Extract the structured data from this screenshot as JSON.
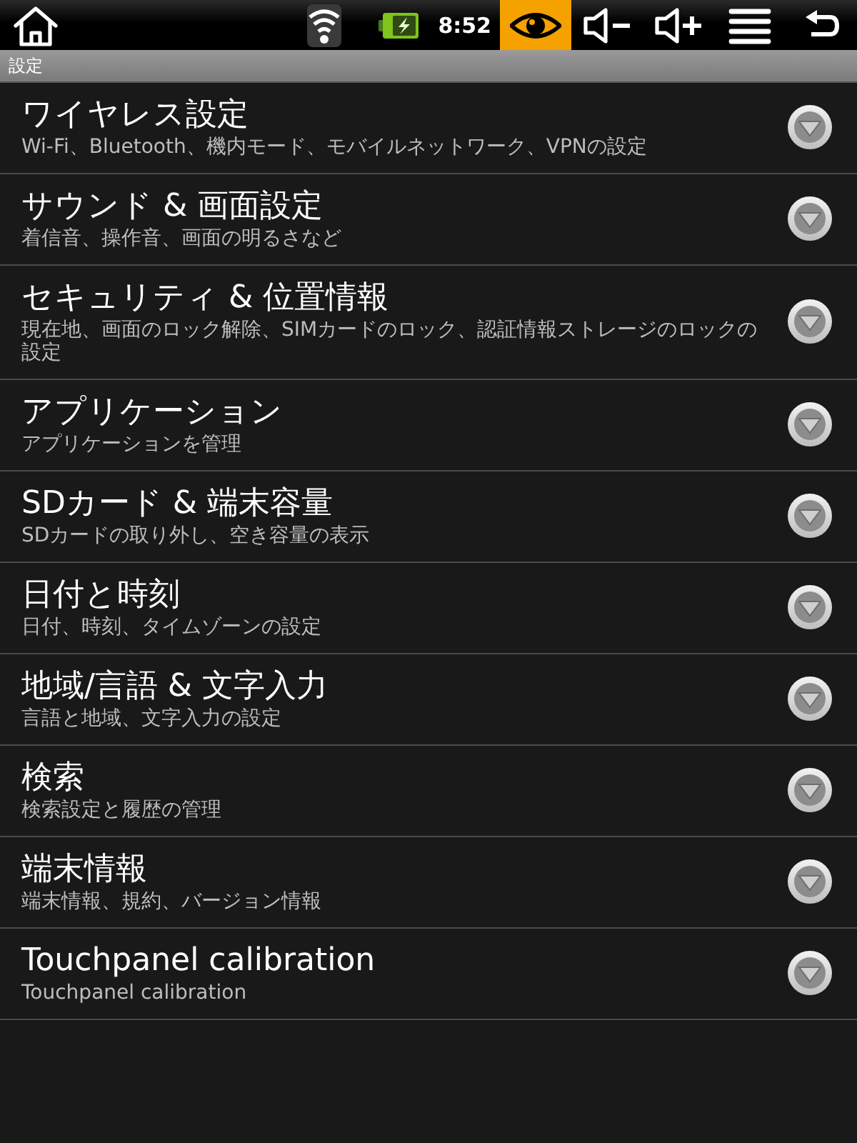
{
  "status_bar": {
    "time": "8:52",
    "buttons": [
      {
        "kind": "home",
        "selected": false
      },
      {
        "kind": "eye",
        "selected": true
      },
      {
        "kind": "volume_down",
        "selected": false
      },
      {
        "kind": "volume_up",
        "selected": false
      },
      {
        "kind": "menu",
        "selected": false
      },
      {
        "kind": "back",
        "selected": false
      }
    ]
  },
  "header": {
    "title": "設定"
  },
  "items": [
    {
      "title": "ワイヤレス設定",
      "summary": "Wi-Fi、Bluetooth、機内モード、モバイルネットワーク、VPNの設定"
    },
    {
      "title": "サウンド & 画面設定",
      "summary": "着信音、操作音、画面の明るさなど"
    },
    {
      "title": "セキュリティ & 位置情報",
      "summary": "現在地、画面のロック解除、SIMカードのロック、認証情報ストレージのロックの設定"
    },
    {
      "title": "アプリケーション",
      "summary": "アプリケーションを管理"
    },
    {
      "title": "SDカード & 端末容量",
      "summary": "SDカードの取り外し、空き容量の表示"
    },
    {
      "title": "日付と時刻",
      "summary": "日付、時刻、タイムゾーンの設定"
    },
    {
      "title": "地域/言語 & 文字入力",
      "summary": "言語と地域、文字入力の設定"
    },
    {
      "title": "検索",
      "summary": "検索設定と履歴の管理"
    },
    {
      "title": "端末情報",
      "summary": "端末情報、規約、バージョン情報"
    },
    {
      "title": "Touchpanel calibration",
      "summary": "Touchpanel calibration"
    }
  ]
}
